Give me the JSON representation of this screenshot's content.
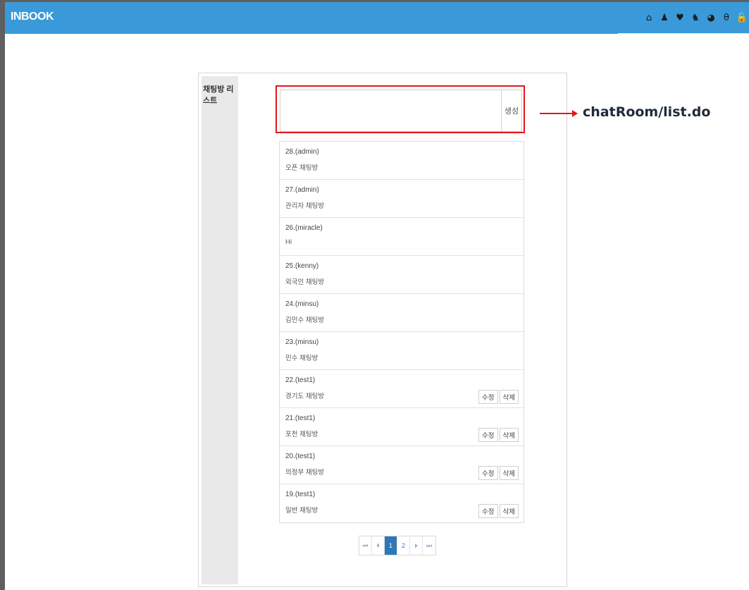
{
  "app": {
    "brand": "INBOOK"
  },
  "nav_icons": [
    "home-icon",
    "user-icon",
    "heart-icon",
    "group-icon",
    "chat-icon",
    "lock-icon",
    "unlock-icon"
  ],
  "nav_glyphs": [
    "⌂",
    "♟",
    "♥",
    "♞",
    "◕",
    "θ",
    "🔓"
  ],
  "sidebar": {
    "label": "채팅방 리스트"
  },
  "create": {
    "input_value": "",
    "button_label": "생성"
  },
  "annotation": {
    "text": "chatRoom/list.do",
    "color": "#e0171b"
  },
  "rooms": [
    {
      "no": "28.(admin)",
      "name": "오픈 채팅방",
      "editable": false
    },
    {
      "no": "27.(admin)",
      "name": "관리자 채팅방",
      "editable": false
    },
    {
      "no": "26.(miracle)",
      "name": "Hi",
      "editable": false
    },
    {
      "no": "25.(kenny)",
      "name": "외국인 채팅방",
      "editable": false
    },
    {
      "no": "24.(minsu)",
      "name": "김민수 채팅방",
      "editable": false
    },
    {
      "no": "23.(minsu)",
      "name": "민수 채팅방",
      "editable": false
    },
    {
      "no": "22.(test1)",
      "name": "경기도 채팅방",
      "editable": true
    },
    {
      "no": "21.(test1)",
      "name": "포천 채팅방",
      "editable": true
    },
    {
      "no": "20.(test1)",
      "name": "의정부 채팅방",
      "editable": true
    },
    {
      "no": "19.(test1)",
      "name": "일반 채팅방",
      "editable": true
    }
  ],
  "room_actions": {
    "edit_label": "수정",
    "delete_label": "삭제"
  },
  "pagination": {
    "first": "⏮",
    "prev": "⏴",
    "pages": [
      "1",
      "2"
    ],
    "current": "1",
    "next": "⏵",
    "last": "⏭"
  },
  "colors": {
    "navbar": "#3a9ad9",
    "accent": "#2e78b8"
  }
}
